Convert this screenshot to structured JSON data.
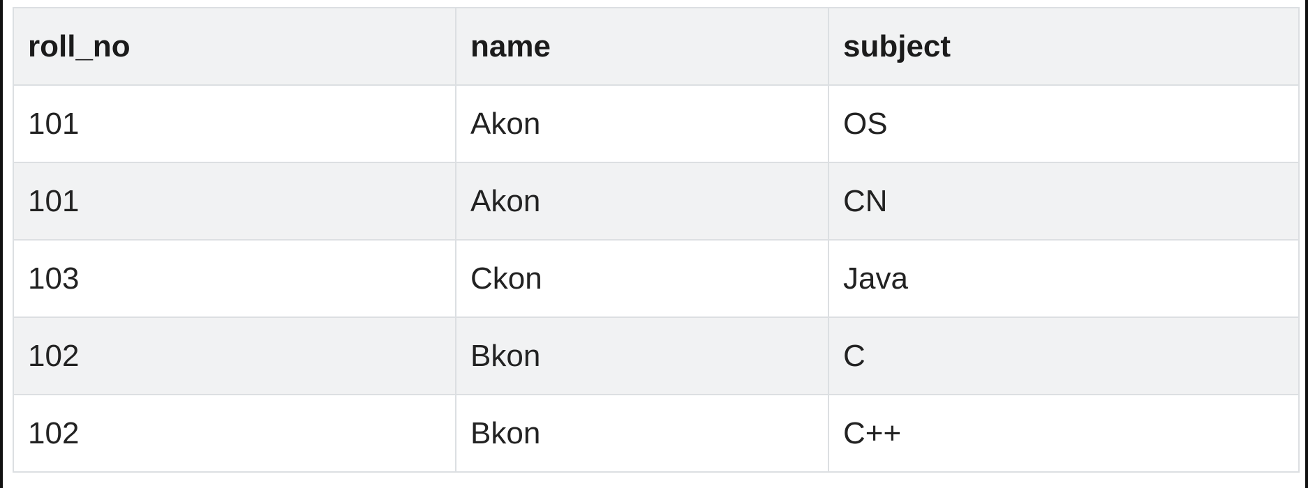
{
  "table": {
    "columns": [
      "roll_no",
      "name",
      "subject"
    ],
    "rows": [
      [
        "101",
        "Akon",
        "OS"
      ],
      [
        "101",
        "Akon",
        "CN"
      ],
      [
        "103",
        "Ckon",
        "Java"
      ],
      [
        "102",
        "Bkon",
        "C"
      ],
      [
        "102",
        "Bkon",
        "C++"
      ]
    ]
  }
}
